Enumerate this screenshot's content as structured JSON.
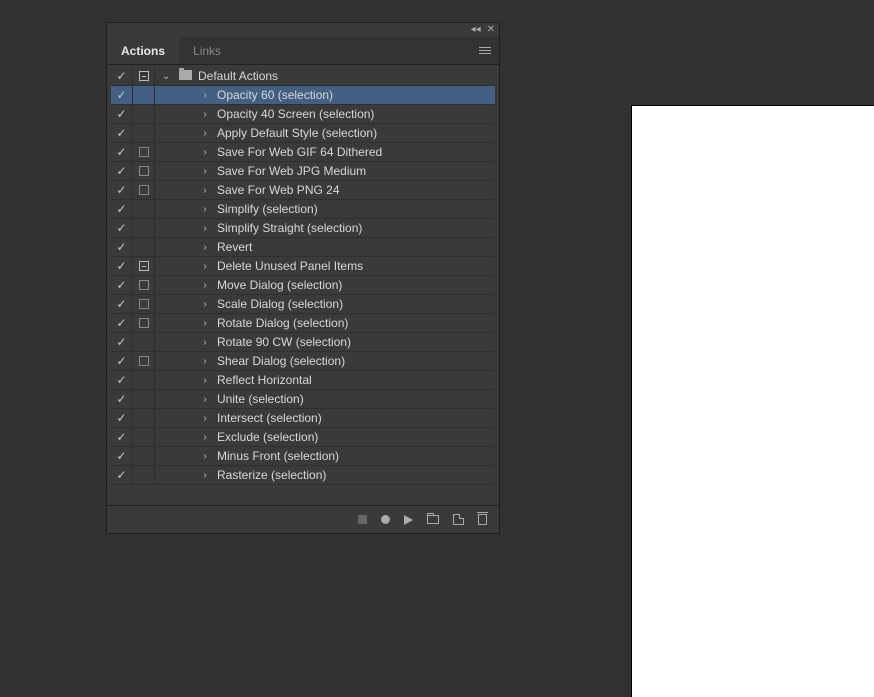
{
  "tabs": {
    "actions": "Actions",
    "links": "Links"
  },
  "set": {
    "name": "Default Actions"
  },
  "actions": [
    {
      "label": "Opacity 60 (selection)",
      "toggle": true,
      "dialog": "",
      "selected": true
    },
    {
      "label": "Opacity 40 Screen (selection)",
      "toggle": true,
      "dialog": ""
    },
    {
      "label": "Apply Default Style (selection)",
      "toggle": true,
      "dialog": ""
    },
    {
      "label": "Save For Web GIF 64 Dithered",
      "toggle": true,
      "dialog": "empty"
    },
    {
      "label": "Save For Web JPG Medium",
      "toggle": true,
      "dialog": "empty"
    },
    {
      "label": "Save For Web PNG 24",
      "toggle": true,
      "dialog": "empty"
    },
    {
      "label": "Simplify (selection)",
      "toggle": true,
      "dialog": ""
    },
    {
      "label": "Simplify Straight (selection)",
      "toggle": true,
      "dialog": ""
    },
    {
      "label": "Revert",
      "toggle": true,
      "dialog": ""
    },
    {
      "label": "Delete Unused Panel Items",
      "toggle": true,
      "dialog": "filled"
    },
    {
      "label": "Move Dialog (selection)",
      "toggle": true,
      "dialog": "empty"
    },
    {
      "label": "Scale Dialog (selection)",
      "toggle": true,
      "dialog": "empty"
    },
    {
      "label": "Rotate Dialog (selection)",
      "toggle": true,
      "dialog": "empty"
    },
    {
      "label": "Rotate 90 CW (selection)",
      "toggle": true,
      "dialog": ""
    },
    {
      "label": "Shear Dialog (selection)",
      "toggle": true,
      "dialog": "empty"
    },
    {
      "label": "Reflect Horizontal",
      "toggle": true,
      "dialog": ""
    },
    {
      "label": "Unite (selection)",
      "toggle": true,
      "dialog": ""
    },
    {
      "label": "Intersect (selection)",
      "toggle": true,
      "dialog": ""
    },
    {
      "label": "Exclude (selection)",
      "toggle": true,
      "dialog": ""
    },
    {
      "label": "Minus Front (selection)",
      "toggle": true,
      "dialog": ""
    },
    {
      "label": "Rasterize (selection)",
      "toggle": true,
      "dialog": ""
    }
  ]
}
